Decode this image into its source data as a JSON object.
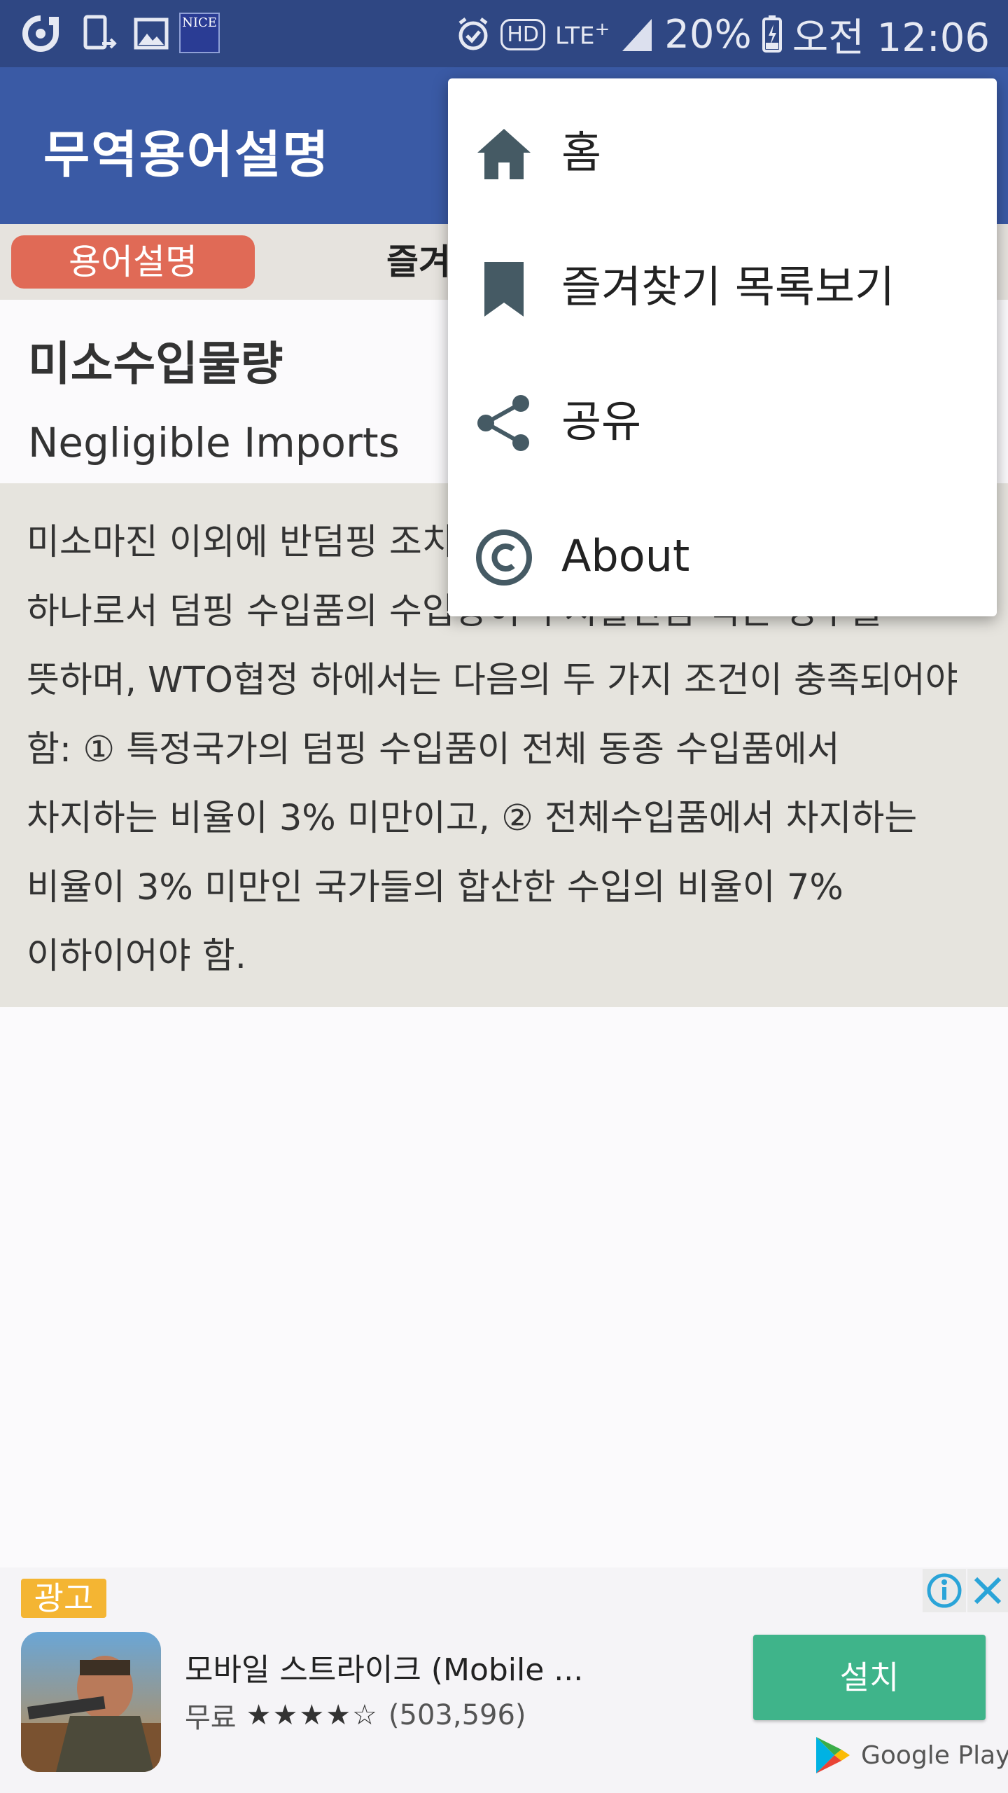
{
  "status_bar": {
    "battery": "20%",
    "time": "오전 12:06",
    "network": "LTE",
    "hd_label": "HD",
    "nice_label": "NICE",
    "icons": [
      "g-icon",
      "device-sync-icon",
      "image-icon",
      "nice-icon",
      "alarm-icon",
      "hd-icon",
      "lte-icon",
      "signal-icon",
      "battery-icon"
    ]
  },
  "toolbar": {
    "title": "무역용어설명"
  },
  "tabs": {
    "term": "용어설명",
    "favorites": "즐겨"
  },
  "term": {
    "korean": "미소수입물량",
    "english": "Negligible Imports",
    "description": "미소마진 이외에 반덤핑 조치의 대상에서 제외되는 요건 중 하나로서 덤핑 수입품의 수입량이 무시할만큼 적은 경우를 뜻하며, WTO협정 하에서는 다음의 두 가지 조건이 충족되어야 함: ① 특정국가의 덤핑 수입품이 전체 동종 수입품에서 차지하는 비율이 3% 미만이고, ② 전체수입품에서 차지하는 비율이 3% 미만인 국가들의 합산한 수입의 비율이 7% 이하이어야 함."
  },
  "menu": {
    "items": [
      {
        "label": "홈",
        "icon": "home-icon"
      },
      {
        "label": "즐겨찾기 목록보기",
        "icon": "bookmark-icon"
      },
      {
        "label": "공유",
        "icon": "share-icon"
      },
      {
        "label": "About",
        "icon": "copyright-icon"
      }
    ]
  },
  "ad": {
    "badge": "광고",
    "app_title": "모바일 스트라이크 (Mobile ...",
    "price": "무료",
    "stars": "★★★★☆",
    "rating_count": "(503,596)",
    "install_label": "설치",
    "store_label": "Google Play"
  },
  "colors": {
    "status_bar": "#2f4783",
    "toolbar": "#3a5aa5",
    "tab_active": "#e06a56",
    "install_button": "#3fb48a",
    "ad_badge": "#f4b533",
    "menu_icon": "#455a64"
  }
}
